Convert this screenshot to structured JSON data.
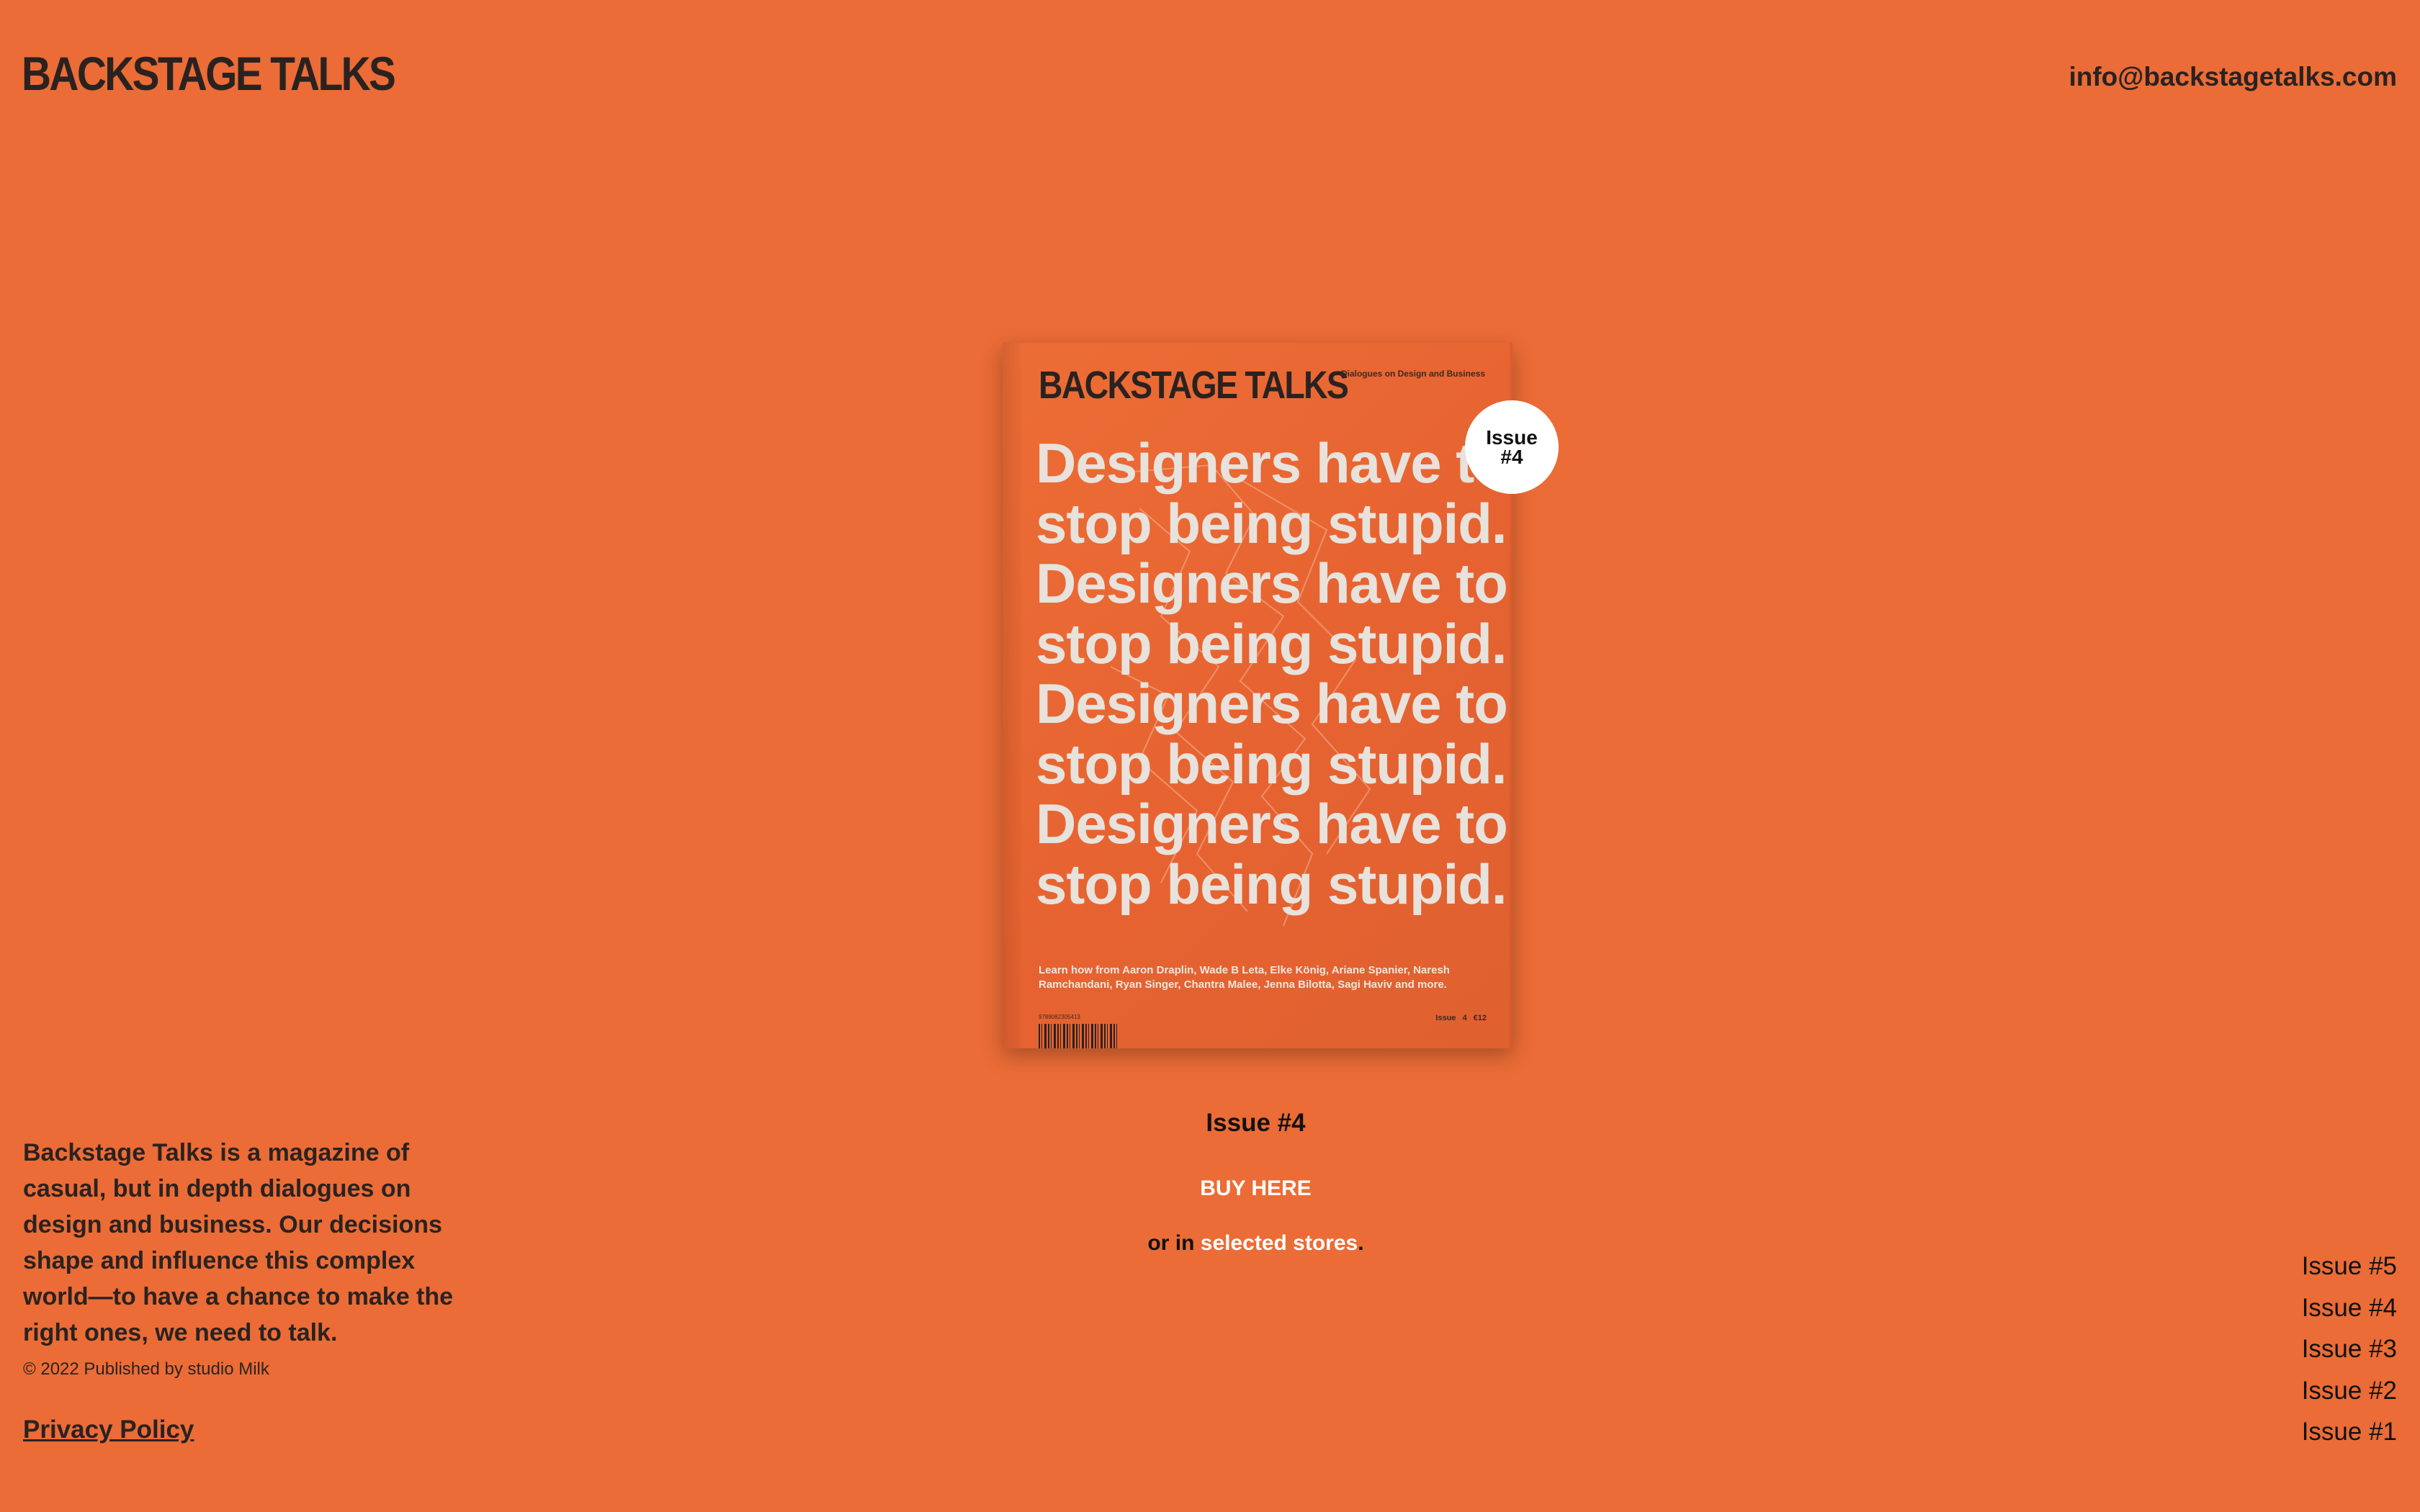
{
  "header": {
    "logo": "BACKSTAGE TALKS",
    "email": "info@backstagetalks.com"
  },
  "cover": {
    "logo": "BACKSTAGE TALKS",
    "tagline": "Dialogues on Design and Business",
    "headline_lines": [
      "Designers have to",
      "stop being stupid.",
      "Designers have to",
      "stop being stupid.",
      "Designers have to",
      "stop being stupid.",
      "Designers have to",
      "stop being stupid."
    ],
    "footer_text_line1": "Learn how from Aaron Draplin, Wade B Leta, Elke König, Ariane Spanier, Naresh",
    "footer_text_line2": "Ramchandani, Ryan Singer, Chantra Malee, Jenna Bilotta, Sagi Haviv and more.",
    "issue_price": "Issue 4 €12",
    "isbn": "9789082305413"
  },
  "badge": {
    "line1": "Issue",
    "line2": "#4"
  },
  "current_issue": {
    "title": "Issue #4",
    "buy_label": "BUY HERE",
    "stores_prefix": "or in ",
    "stores_link": "selected stores",
    "stores_suffix": "."
  },
  "about": {
    "text": "Backstage Talks is a magazine of casual, but in depth dialogues on design and business. Our decisions shape and influence this complex world—to have a chance to make the right ones, we need to talk.",
    "copyright": "© 2022 Published by studio Milk",
    "privacy_label": "Privacy Policy"
  },
  "issues_nav": [
    "Issue #5",
    "Issue #4",
    "Issue #3",
    "Issue #2",
    "Issue #1"
  ],
  "colors": {
    "background": "#EB6C36",
    "text": "#2b2220",
    "highlight": "#ffffff"
  }
}
